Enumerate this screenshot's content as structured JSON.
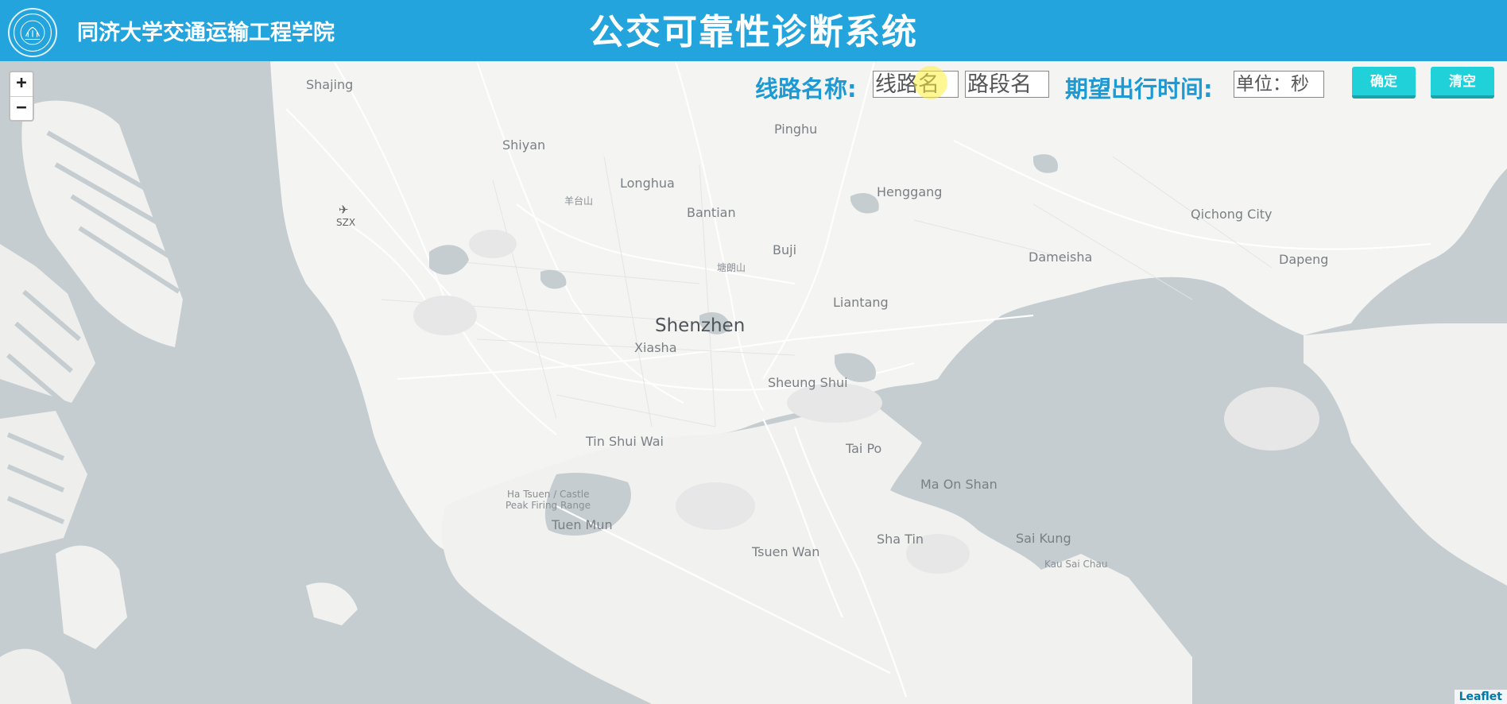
{
  "header": {
    "org_name": "同济大学交通运输工程学院",
    "app_title": "公交可靠性诊断系统",
    "logo_icon": "university-seal-icon"
  },
  "toolbar": {
    "route_label": "线路名称:",
    "route_input_placeholder": "线路名",
    "segment_input_placeholder": "路段名",
    "time_label": "期望出行时间:",
    "time_input_placeholder": "单位：秒",
    "confirm_label": "确定",
    "clear_label": "清空"
  },
  "map": {
    "zoom_in": "+",
    "zoom_out": "−",
    "attribution": "Leaflet",
    "airport_code": "SZX",
    "places": {
      "shajing": "Shajing",
      "shiyan": "Shiyan",
      "pinghu": "Pinghu",
      "longhua": "Longhua",
      "yangtaishan": "羊台山",
      "bantian": "Bantian",
      "henggang": "Henggang",
      "qichong": "Qichong City",
      "buji": "Buji",
      "tanglangshan": "塘朗山",
      "dameisha": "Dameisha",
      "dapeng": "Dapeng",
      "liantang": "Liantang",
      "shenzhen": "Shenzhen",
      "xiasha": "Xiasha",
      "sheungshui": "Sheung Shui",
      "tinshuiwai": "Tin Shui Wai",
      "taipo": "Tai Po",
      "hatsuen1": "Ha Tsuen / Castle",
      "hatsuen2": "Peak Firing Range",
      "tuenmun": "Tuen Mun",
      "maonshan": "Ma On Shan",
      "shatin": "Sha Tin",
      "saikung": "Sai Kung",
      "tsuenwan": "Tsuen Wan",
      "kausaichau": "Kau Sai Chau"
    }
  }
}
